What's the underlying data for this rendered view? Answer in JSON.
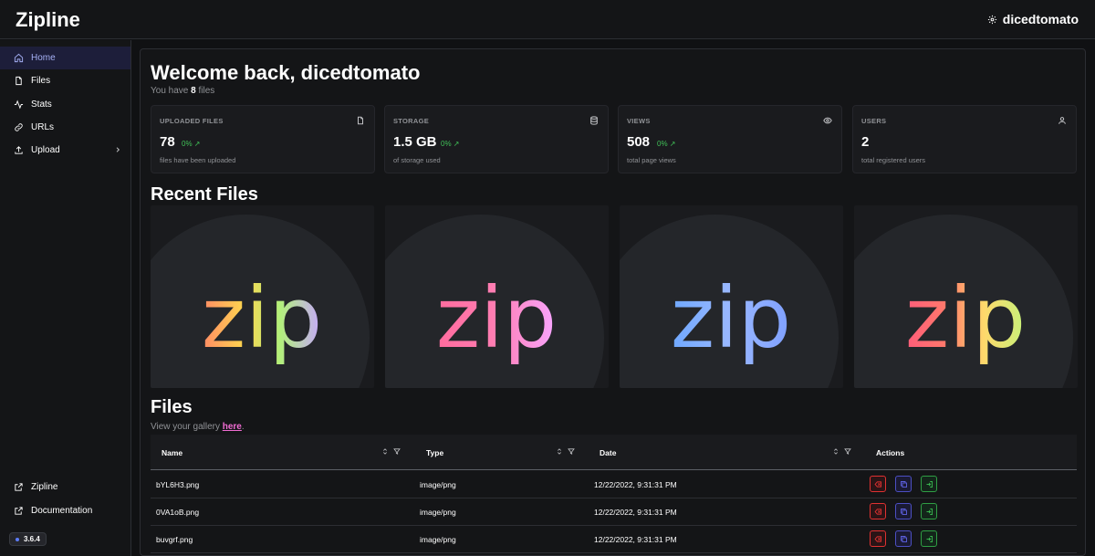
{
  "app": {
    "title": "Zipline"
  },
  "header": {
    "username": "dicedtomato"
  },
  "sidebar": {
    "items": [
      {
        "label": "Home",
        "icon": "home-icon",
        "active": true
      },
      {
        "label": "Files",
        "icon": "file-icon"
      },
      {
        "label": "Stats",
        "icon": "activity-icon"
      },
      {
        "label": "URLs",
        "icon": "link-icon"
      },
      {
        "label": "Upload",
        "icon": "upload-icon",
        "has_submenu": true
      }
    ],
    "footer_links": [
      {
        "label": "Zipline",
        "icon": "external-link-icon"
      },
      {
        "label": "Documentation",
        "icon": "external-link-icon"
      }
    ],
    "version": "3.6.4"
  },
  "welcome": {
    "title": "Welcome back, dicedtomato",
    "subtitle_prefix": "You have",
    "file_count": "8",
    "subtitle_suffix": "files"
  },
  "stats": [
    {
      "title": "UPLOADED FILES",
      "value": "78",
      "diff": "0%",
      "desc": "files have been uploaded",
      "icon": "file-icon"
    },
    {
      "title": "STORAGE",
      "value": "1.5 GB",
      "diff": "0%",
      "desc": "of storage used",
      "icon": "database-icon"
    },
    {
      "title": "VIEWS",
      "value": "508",
      "diff": "0%",
      "desc": "total page views",
      "icon": "eye-icon"
    },
    {
      "title": "USERS",
      "value": "2",
      "diff": "",
      "desc": "total registered users",
      "icon": "user-icon"
    }
  ],
  "recent_files": {
    "title": "Recent Files",
    "thumbnails": [
      {
        "text": "zip",
        "colors": [
          "#ff8a65",
          "#ffd54f",
          "#b2f07a",
          "#c7a6ff"
        ]
      },
      {
        "text": "zip",
        "colors": [
          "#ff6b9d",
          "#ff7eb3",
          "#ff9de0",
          "#f7a6ff"
        ]
      },
      {
        "text": "zip",
        "colors": [
          "#6fa8ff",
          "#9ab8ff",
          "#a5b4ff",
          "#7fa0ff"
        ]
      },
      {
        "text": "zip",
        "colors": [
          "#ff5c7a",
          "#ff7a6b",
          "#ffd86b",
          "#c6f27a"
        ]
      }
    ]
  },
  "files": {
    "title": "Files",
    "subtitle_prefix": "View your gallery",
    "link_label": "here",
    "subtitle_suffix": ".",
    "columns": [
      "Name",
      "Type",
      "Date",
      "Actions"
    ],
    "rows": [
      {
        "name": "bYL6H3.png",
        "type": "image/png",
        "date": "12/22/2022, 9:31:31 PM"
      },
      {
        "name": "0VA1oB.png",
        "type": "image/png",
        "date": "12/22/2022, 9:31:31 PM"
      },
      {
        "name": "buvgrf.png",
        "type": "image/png",
        "date": "12/22/2022, 9:31:31 PM"
      }
    ]
  },
  "colors": {
    "accent": "#a5b0f5",
    "positive": "#40c057",
    "danger": "#e03131",
    "link": "#f06cd2"
  }
}
